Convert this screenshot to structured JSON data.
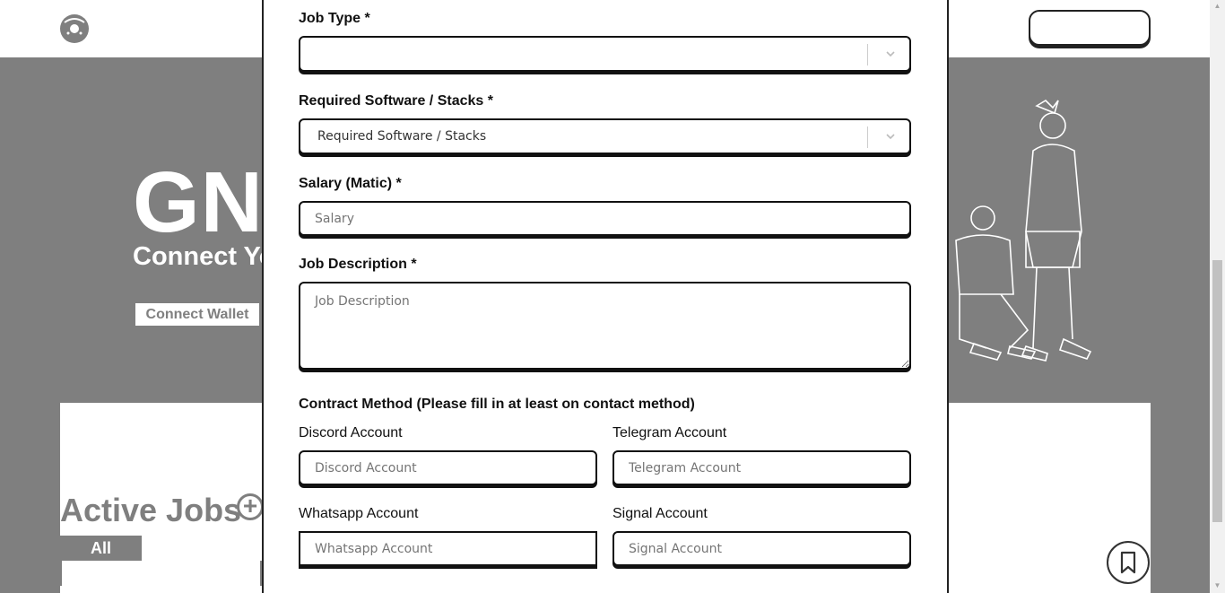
{
  "background": {
    "hero_title": "GN",
    "hero_subtitle": "Connect Yo",
    "connect_wallet": "Connect Wallet",
    "active_jobs": "Active Jobs",
    "add_symbol": "+",
    "tab_all": "All"
  },
  "modal": {
    "job_type": {
      "label": "Job Type *",
      "value": ""
    },
    "software": {
      "label": "Required Software / Stacks *",
      "value": "Required Software / Stacks"
    },
    "salary": {
      "label": "Salary (Matic) *",
      "placeholder": "Salary"
    },
    "description": {
      "label": "Job Description *",
      "placeholder": "Job Description"
    },
    "contact_heading": "Contract Method (Please fill in at least on contact method)",
    "discord": {
      "label": "Discord Account",
      "placeholder": "Discord Account"
    },
    "telegram": {
      "label": "Telegram Account",
      "placeholder": "Telegram Account"
    },
    "whatsapp": {
      "label": "Whatsapp Account",
      "placeholder": "Whatsapp Account"
    },
    "signal": {
      "label": "Signal Account",
      "placeholder": "Signal Account"
    }
  },
  "colors": {
    "overlay": "#7f7f7f",
    "border": "#111111"
  }
}
